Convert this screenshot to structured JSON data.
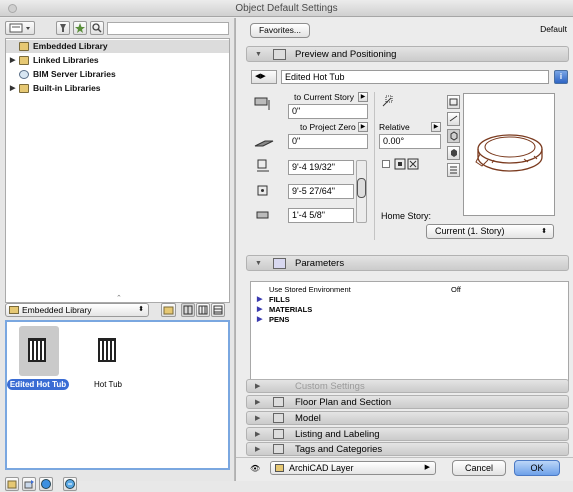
{
  "window": {
    "title": "Object Default Settings"
  },
  "left": {
    "tree": [
      {
        "label": "Embedded Library",
        "expanded": false
      },
      {
        "label": "Linked Libraries",
        "expanded": false
      },
      {
        "label": "BIM Server Libraries",
        "expanded": false
      },
      {
        "label": "Built-in Libraries",
        "expanded": false
      }
    ],
    "library_select": "Embedded Library",
    "items": [
      {
        "name": "Edited Hot Tub",
        "selected": true
      },
      {
        "name": "Hot Tub",
        "selected": false
      }
    ]
  },
  "right": {
    "favorites_label": "Favorites...",
    "default_label": "Default",
    "preview_section": "Preview and Positioning",
    "object_name": "Edited Hot Tub",
    "to_current_story_label": "to Current Story",
    "to_current_story_value": "0\"",
    "to_project_zero_label": "to Project Zero",
    "to_project_zero_value": "0\"",
    "relative_label": "Relative",
    "angle_value": "0.00°",
    "width_value": "9'-4 19/32\"",
    "depth_value": "9'-5 27/64\"",
    "height_value": "1'-4 5/8\"",
    "home_story_label": "Home Story:",
    "home_story_value": "Current (1. Story)",
    "parameters_section": "Parameters",
    "params": [
      {
        "name": "Use Stored Environment",
        "value": "Off",
        "group": false
      },
      {
        "name": "FILLS",
        "value": "",
        "group": true
      },
      {
        "name": "MATERIALS",
        "value": "",
        "group": true
      },
      {
        "name": "PENS",
        "value": "",
        "group": true
      }
    ],
    "sections": [
      {
        "label": "Custom Settings",
        "disabled": true
      },
      {
        "label": "Floor Plan and Section",
        "disabled": false
      },
      {
        "label": "Model",
        "disabled": false
      },
      {
        "label": "Listing and Labeling",
        "disabled": false
      },
      {
        "label": "Tags and Categories",
        "disabled": false
      }
    ],
    "layer_value": "ArchiCAD Layer",
    "cancel_label": "Cancel",
    "ok_label": "OK"
  }
}
